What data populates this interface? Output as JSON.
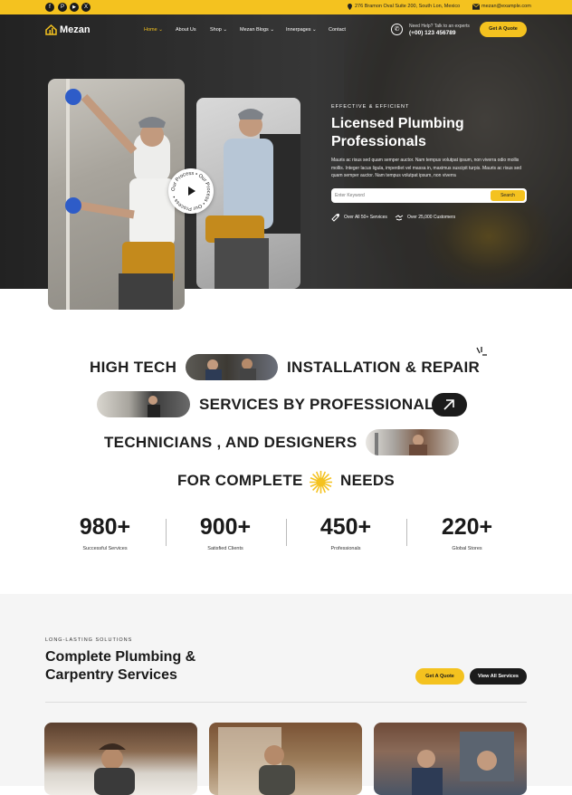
{
  "topbar": {
    "social": [
      "f",
      "P",
      "▶",
      "X"
    ],
    "address": "276 Bramon Oval Suite 200, South Lon, Mexico",
    "email": "mezan@example.com"
  },
  "header": {
    "logo": "Mezan",
    "nav": [
      {
        "label": "Home",
        "chevron": true,
        "active": true
      },
      {
        "label": "About Us",
        "chevron": false
      },
      {
        "label": "Shop",
        "chevron": true
      },
      {
        "label": "Mezan Blogs",
        "chevron": true
      },
      {
        "label": "Innerpages",
        "chevron": true
      },
      {
        "label": "Contact",
        "chevron": false
      }
    ],
    "help_label": "Need Help? Talk to an experts",
    "help_phone": "(+00) 123 456789",
    "cta": "Get A Quote"
  },
  "hero": {
    "eyebrow": "EFFECTIVE & EFFICIENT",
    "title_line1": "Licensed Plumbing",
    "title_line2": "Professionals",
    "paragraph": "Mauris ac risus sed quam semper auctor. Nam tempus volutpat ipsum, non viverra odio mollis mollis. Integer lacus ligula, imperdiet vel massa in, maximus suscipit turpis. Mauris ac risus sed quam semper auctor. Nam tempus volutpat ipsum, non viverra",
    "search_placeholder": "Enter Keyword",
    "search_button": "Search",
    "feature1": "Over All 50+ Services",
    "feature2": "Over 25,000 Customers",
    "badge_text": "Our Process • Our Process • Our Process •"
  },
  "marquee": {
    "line1a": "HIGH TECH",
    "line1b": "INSTALLATION & REPAIR",
    "line2": "SERVICES BY PROFESSIONAL",
    "line3": "TECHNICIANS ,  AND DESIGNERS",
    "line4a": "FOR COMPLETE",
    "line4b": "NEEDS"
  },
  "stats": [
    {
      "value": "980+",
      "label": "Successful Services"
    },
    {
      "value": "900+",
      "label": "Satisfied Clients"
    },
    {
      "value": "450+",
      "label": "Professionals"
    },
    {
      "value": "220+",
      "label": "Global Stores"
    }
  ],
  "services": {
    "eyebrow": "LONG-LASTING SOLUTIONS",
    "title_line1": "Complete Plumbing &",
    "title_line2": "Carpentry Services",
    "btn_quote": "Get A Quote",
    "btn_all": "View All Services"
  },
  "colors": {
    "accent": "#f4c21f",
    "dark": "#1b1b1b"
  }
}
